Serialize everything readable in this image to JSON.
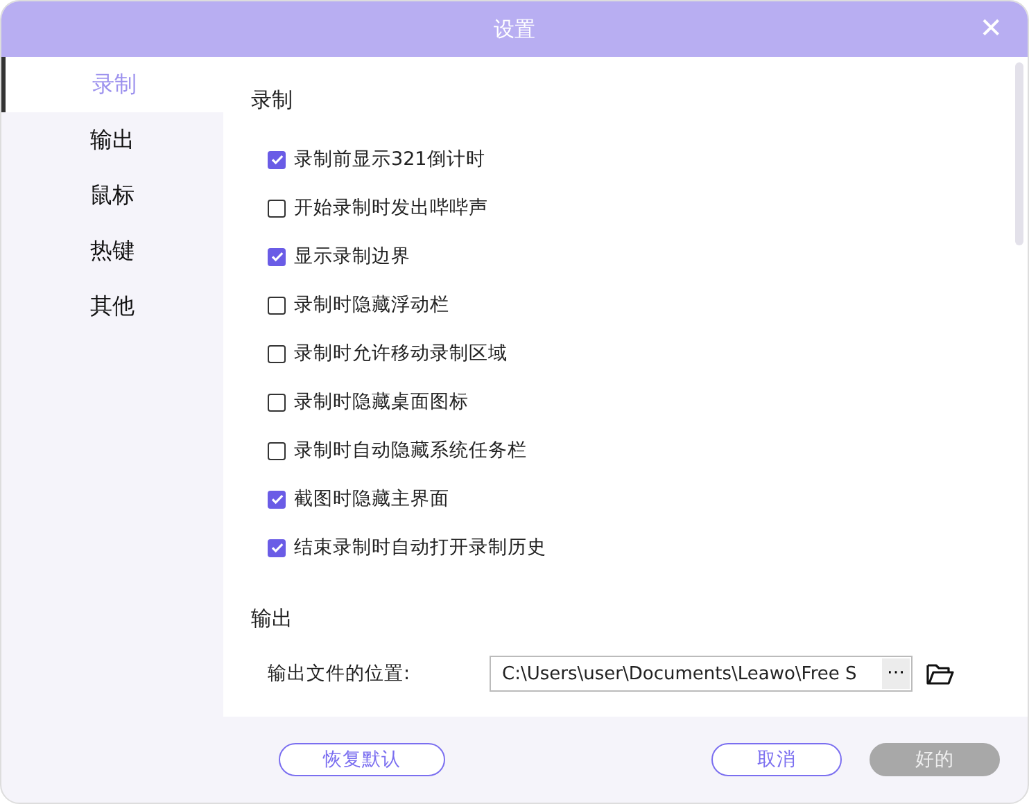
{
  "window": {
    "title": "设置",
    "close": "✕"
  },
  "sidebar": {
    "items": [
      {
        "label": "录制",
        "selected": true
      },
      {
        "label": "输出",
        "selected": false
      },
      {
        "label": "鼠标",
        "selected": false
      },
      {
        "label": "热键",
        "selected": false
      },
      {
        "label": "其他",
        "selected": false
      }
    ]
  },
  "sections": [
    {
      "title": "录制",
      "options": [
        {
          "label": "录制前显示321倒计时",
          "checked": true
        },
        {
          "label": "开始录制时发出哔哔声",
          "checked": false
        },
        {
          "label": "显示录制边界",
          "checked": true
        },
        {
          "label": "录制时隐藏浮动栏",
          "checked": false
        },
        {
          "label": "录制时允许移动录制区域",
          "checked": false
        },
        {
          "label": "录制时隐藏桌面图标",
          "checked": false
        },
        {
          "label": "录制时自动隐藏系统任务栏",
          "checked": false
        },
        {
          "label": "截图时隐藏主界面",
          "checked": true
        },
        {
          "label": "结束录制时自动打开录制历史",
          "checked": true
        }
      ]
    },
    {
      "title": "输出",
      "paths": [
        {
          "label": "输出文件的位置:",
          "value": "C:\\Users\\user\\Documents\\Leawo\\Free S",
          "browse": "⋯"
        }
      ]
    }
  ],
  "footer": {
    "buttons": [
      {
        "label": "恢复默认",
        "kind": "outline",
        "disabled": false
      },
      {
        "label": "取消",
        "kind": "outline",
        "disabled": false
      },
      {
        "label": "好的",
        "kind": "primary",
        "disabled": true
      }
    ]
  }
}
